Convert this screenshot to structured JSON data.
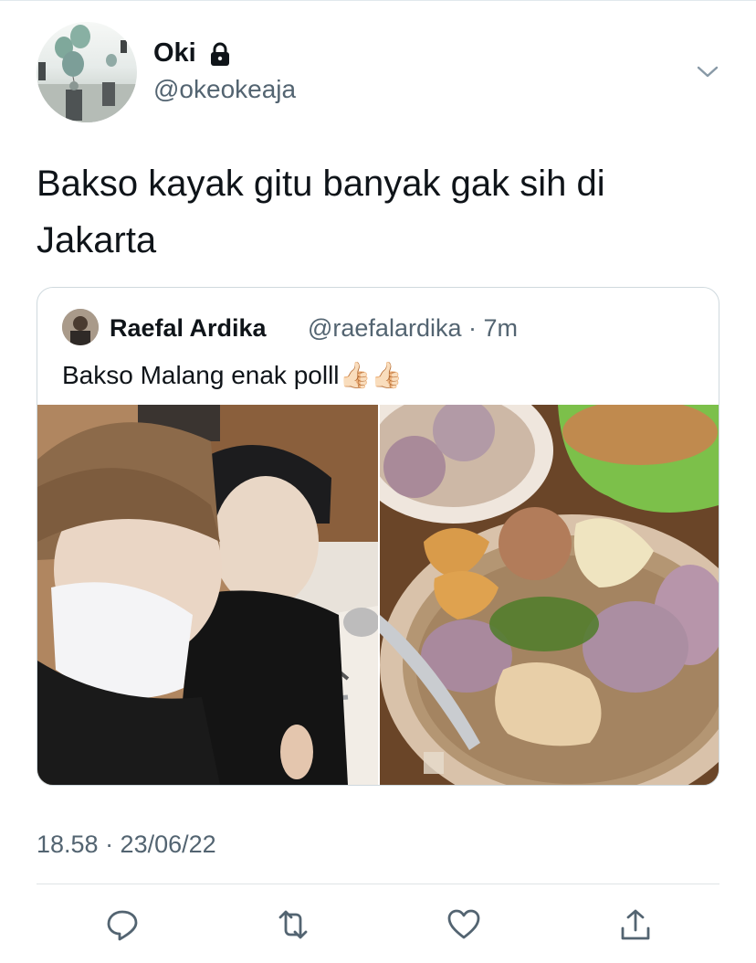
{
  "tweet": {
    "author": {
      "display_name": "Oki",
      "handle": "@okeokeaja",
      "lock_icon": "lock-icon",
      "verified": false
    },
    "text": "Bakso kayak gitu banyak gak sih di Jakarta",
    "timestamp": "18.58 · 23/06/22"
  },
  "quoted": {
    "author": {
      "display_name": "Raefal Ardika",
      "handle": "@raefalardika · 7m"
    },
    "text": "Bakso Malang enak polll👍🏻👍🏻",
    "images": [
      {
        "icon": "selfie-photo",
        "alt": ""
      },
      {
        "icon": "bakso-bowl-photo",
        "alt": ""
      }
    ]
  },
  "actions": [
    {
      "icon": "reply-icon"
    },
    {
      "icon": "retweet-icon"
    },
    {
      "icon": "like-icon"
    },
    {
      "icon": "share-icon"
    }
  ],
  "colors": {
    "text": "#0f1419",
    "secondary": "#536471",
    "border": "#cfd9de",
    "bowl_green": "#7cc04a"
  }
}
